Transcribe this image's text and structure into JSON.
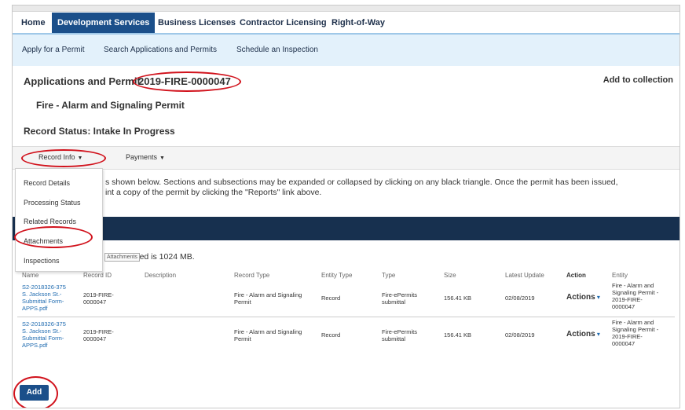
{
  "nav": {
    "tabs": [
      "Home",
      "Development Services",
      "Business Licenses",
      "Contractor Licensing",
      "Right-of-Way"
    ],
    "active": "Development Services"
  },
  "subnav": [
    "Apply for a Permit",
    "Search Applications and Permits",
    "Schedule an Inspection"
  ],
  "header": {
    "title": "Applications and Permit",
    "record_number": "2019-FIRE-0000047",
    "add_collection": "Add to collection",
    "permit_type": "Fire - Alarm and Signaling Permit",
    "record_status": "Record Status: Intake In Progress"
  },
  "tabsbar": {
    "record_info": "Record Info",
    "payments": "Payments"
  },
  "dropdown": {
    "items": [
      "Record Details",
      "Processing Status",
      "Related Records",
      "Attachments",
      "Inspections"
    ],
    "tooltip": "Attachments"
  },
  "description": {
    "line1": "s shown below. Sections and subsections may be expanded or collapsed by clicking on any black triangle. Once the permit has been issued,",
    "line2": "int a copy of the permit by clicking the \"Reports\" link above."
  },
  "max_size_text": "wed is 1024 MB.",
  "table": {
    "headers": {
      "name": "Name",
      "record_id": "Record ID",
      "description": "Description",
      "record_type": "Record Type",
      "entity_type": "Entity Type",
      "type": "Type",
      "size": "Size",
      "latest_update": "Latest Update",
      "action": "Action",
      "entity": "Entity"
    },
    "rows": [
      {
        "name": [
          "S2-2018326-375",
          "S. Jackson St.-",
          "Submittal Form-",
          "APPS.pdf"
        ],
        "record_id": [
          "2019-FIRE-",
          "0000047"
        ],
        "description": "",
        "record_type": [
          "Fire - Alarm and Signaling",
          "Permit"
        ],
        "entity_type": "Record",
        "type": [
          "Fire-ePermits",
          "submittal"
        ],
        "size": "156.41 KB",
        "latest_update": "02/08/2019",
        "action": "Actions",
        "entity": [
          "Fire - Alarm and",
          "Signaling Permit -",
          "2019-FIRE-",
          "0000047"
        ]
      },
      {
        "name": [
          "S2-2018326-375",
          "S. Jackson St.-",
          "Submittal Form-",
          "APPS.pdf"
        ],
        "record_id": [
          "2019-FIRE-",
          "0000047"
        ],
        "description": "",
        "record_type": [
          "Fire - Alarm and Signaling",
          "Permit"
        ],
        "entity_type": "Record",
        "type": [
          "Fire-ePermits",
          "submittal"
        ],
        "size": "156.41 KB",
        "latest_update": "02/08/2019",
        "action": "Actions",
        "entity": [
          "Fire - Alarm and",
          "Signaling Permit -",
          "2019-FIRE-",
          "0000047"
        ]
      }
    ]
  },
  "add_button": "Add",
  "colors": {
    "nav_active": "#1b4f8a",
    "subnav_bg": "#e3f1fb",
    "dark_bar": "#17304f",
    "link": "#1f6bb0",
    "annotation": "#d1121c"
  }
}
